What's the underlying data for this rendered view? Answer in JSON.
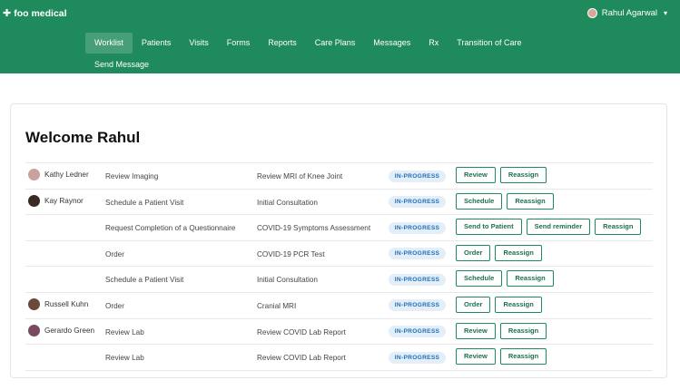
{
  "app": {
    "logo_text": "foo medical",
    "user_name": "Rahul Agarwal"
  },
  "nav": {
    "items": [
      "Worklist",
      "Patients",
      "Visits",
      "Forms",
      "Reports",
      "Care Plans",
      "Messages",
      "Rx",
      "Transition of Care"
    ],
    "active": "Worklist",
    "second_row": "Send Message"
  },
  "page": {
    "title": "Welcome Rahul"
  },
  "colors": {
    "brand_green": "#1f8a5b",
    "status_badge_bg": "#e3eef9",
    "status_badge_text": "#1d6fb8"
  },
  "rows": [
    {
      "patient": "Kathy Ledner",
      "avatar_color": "#c9a2a0",
      "task": "Review Imaging",
      "description": "Review MRI of Knee Joint",
      "status": "IN-PROGRESS",
      "actions": [
        "Review",
        "Reassign"
      ]
    },
    {
      "patient": "Kay Raynor",
      "avatar_color": "#3b2a24",
      "task": "Schedule a Patient Visit",
      "description": "Initial Consultation",
      "status": "IN-PROGRESS",
      "actions": [
        "Schedule",
        "Reassign"
      ]
    },
    {
      "patient": "",
      "avatar_color": "",
      "task": "Request Completion of a Questionnaire",
      "description": "COVID-19 Symptoms Assessment",
      "status": "IN-PROGRESS",
      "actions": [
        "Send to Patient",
        "Send reminder",
        "Reassign"
      ]
    },
    {
      "patient": "",
      "avatar_color": "",
      "task": "Order",
      "description": "COVID-19 PCR Test",
      "status": "IN-PROGRESS",
      "actions": [
        "Order",
        "Reassign"
      ]
    },
    {
      "patient": "",
      "avatar_color": "",
      "task": "Schedule a Patient Visit",
      "description": "Initial Consultation",
      "status": "IN-PROGRESS",
      "actions": [
        "Schedule",
        "Reassign"
      ]
    },
    {
      "patient": "Russell Kuhn",
      "avatar_color": "#6b4a3a",
      "task": "Order",
      "description": "Cranial MRI",
      "status": "IN-PROGRESS",
      "actions": [
        "Order",
        "Reassign"
      ]
    },
    {
      "patient": "Gerardo Green",
      "avatar_color": "#7a4b5f",
      "task": "Review Lab",
      "description": "Review COVID Lab Report",
      "status": "IN-PROGRESS",
      "actions": [
        "Review",
        "Reassign"
      ]
    },
    {
      "patient": "",
      "avatar_color": "",
      "task": "Review Lab",
      "description": "Review COVID Lab Report",
      "status": "IN-PROGRESS",
      "actions": [
        "Review",
        "Reassign"
      ]
    }
  ]
}
